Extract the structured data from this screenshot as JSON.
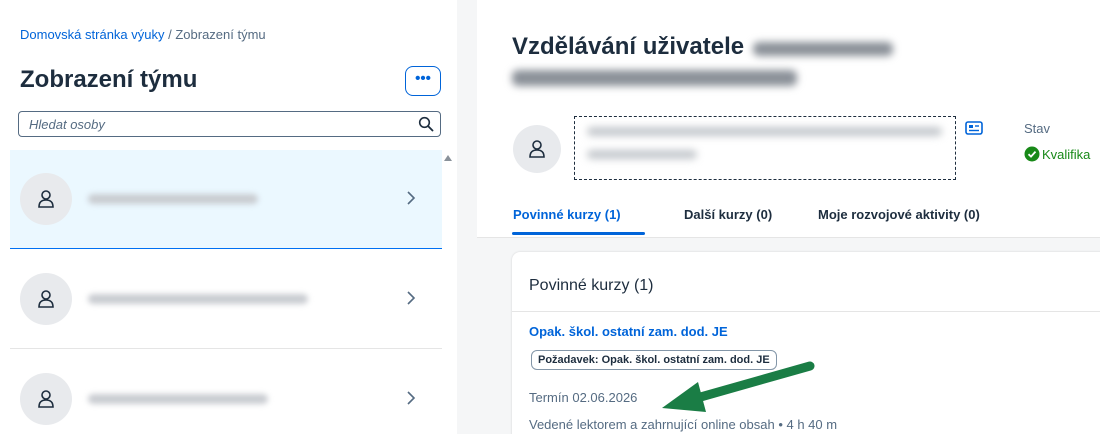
{
  "breadcrumb": {
    "home": "Domovská stránka výuky",
    "separator": " / ",
    "current": "Zobrazení týmu"
  },
  "left": {
    "title": "Zobrazení týmu",
    "more_label": "•••",
    "search": {
      "placeholder": "Hledat osoby",
      "value": ""
    },
    "people": [
      {
        "selected": true
      },
      {
        "selected": false
      },
      {
        "selected": false
      }
    ]
  },
  "right": {
    "title": "Vzdělávání uživatele",
    "status_label": "Stav",
    "status_value": "Kvalifika",
    "tabs": [
      {
        "label": "Povinné kurzy (1)",
        "active": true
      },
      {
        "label": "Další kurzy (0)",
        "active": false
      },
      {
        "label": "Moje rozvojové aktivity (0)",
        "active": false
      }
    ],
    "card": {
      "title": "Povinné kurzy (1)",
      "course_title": "Opak. škol. ostatní zam. dod. JE",
      "requirement": "Požadavek: Opak. škol. ostatní zam. dod. JE",
      "deadline": "Termín 02.06.2026",
      "meta": "Vedené lektorem a zahrnující online obsah • 4 h 40 m"
    }
  },
  "colors": {
    "accent": "#0064d9",
    "success": "#188918",
    "arrow": "#1a7d45",
    "selected_bg": "#ebf8ff"
  }
}
